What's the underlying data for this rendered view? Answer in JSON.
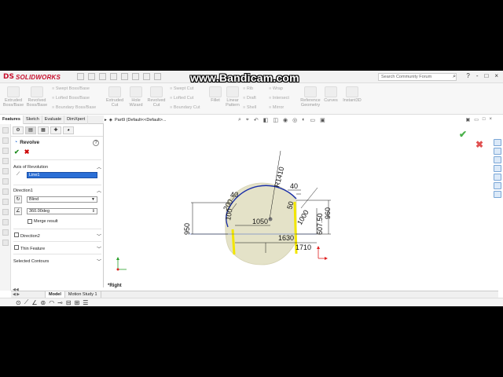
{
  "app": {
    "brand": "SOLIDWORKS",
    "logo_mark": "DS",
    "watermark": "www.Bandicam.com",
    "search_placeholder": "Search Community Forum",
    "search_icon": "magnifier-icon",
    "window_controls": [
      "?",
      "-",
      "□",
      "×"
    ]
  },
  "ribbon": {
    "large_buttons": [
      {
        "label": "Extruded Boss/Base"
      },
      {
        "label": "Revolved Boss/Base"
      },
      {
        "label": "Extruded Cut"
      },
      {
        "label": "Hole Wizard"
      },
      {
        "label": "Revolved Cut"
      },
      {
        "label": "Fillet"
      },
      {
        "label": "Linear Pattern"
      },
      {
        "label": "Reference Geometry"
      },
      {
        "label": "Curves"
      },
      {
        "label": "Instant3D"
      }
    ],
    "small_buttons": [
      "Swept Boss/Base",
      "Lofted Boss/Base",
      "Boundary Boss/Base",
      "Swept Cut",
      "Lofted Cut",
      "Boundary Cut",
      "Rib",
      "Draft",
      "Shell",
      "Wrap",
      "Intersect",
      "Mirror"
    ]
  },
  "command_tabs": [
    "Features",
    "Sketch",
    "Evaluate",
    "DimXpert"
  ],
  "property_manager": {
    "title": "Revolve",
    "help": "?",
    "ok": "✔",
    "cancel": "✖",
    "axis_section": "Axis of Revolution",
    "axis_value": "Line1",
    "direction1_section": "Direction1",
    "end_condition": "Blind",
    "angle": "360.00deg",
    "merge_result": "Merge result",
    "direction2_section": "Direction2",
    "thin_feature": "Thin Feature",
    "selected_contours": "Selected Contours"
  },
  "viewport": {
    "tree_label": "Part9 (Default<<Default>...",
    "view_name": "*Right",
    "dimensions": {
      "radius": "R1410",
      "d40_top": "40",
      "d40_left": "40",
      "d200": "200",
      "d100": "100",
      "d50": "50",
      "d1000": "1000",
      "d1050": "1050",
      "d1630": "1630",
      "d1710": "1710",
      "d950": "950",
      "d607_50": "607.50",
      "d960": "960"
    },
    "colors": {
      "model_fill": "#e4e2c8",
      "arc": "#1a2fa8",
      "highlight": "#f2e600",
      "axis_red": "#e02020",
      "axis_green": "#2aa02a"
    }
  },
  "bottom_tabs": [
    "Model",
    "Motion Study 1"
  ],
  "bottom_tab_arrows": "◀◀ ◀ ▶ ▶▶"
}
